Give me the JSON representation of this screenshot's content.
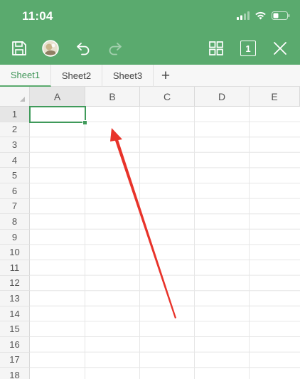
{
  "status_bar": {
    "time": "11:04"
  },
  "toolbar": {
    "save": "save-icon",
    "avatar": "avatar",
    "undo": "undo-icon",
    "redo": "redo-icon",
    "grid_view": "grid-view-icon",
    "sheet_count": "1",
    "close": "close-icon"
  },
  "tabs": [
    {
      "label": "Sheet1",
      "active": true
    },
    {
      "label": "Sheet2",
      "active": false
    },
    {
      "label": "Sheet3",
      "active": false
    }
  ],
  "add_tab": "+",
  "columns": [
    "A",
    "B",
    "C",
    "D",
    "E"
  ],
  "rows": [
    "1",
    "2",
    "3",
    "4",
    "5",
    "6",
    "7",
    "8",
    "9",
    "10",
    "11",
    "12",
    "13",
    "14",
    "15",
    "16",
    "17",
    "18"
  ],
  "selected_cell": "A1",
  "colors": {
    "brand": "#5aaa6e",
    "selection": "#3f9a5a",
    "annotation": "#e8332a"
  }
}
